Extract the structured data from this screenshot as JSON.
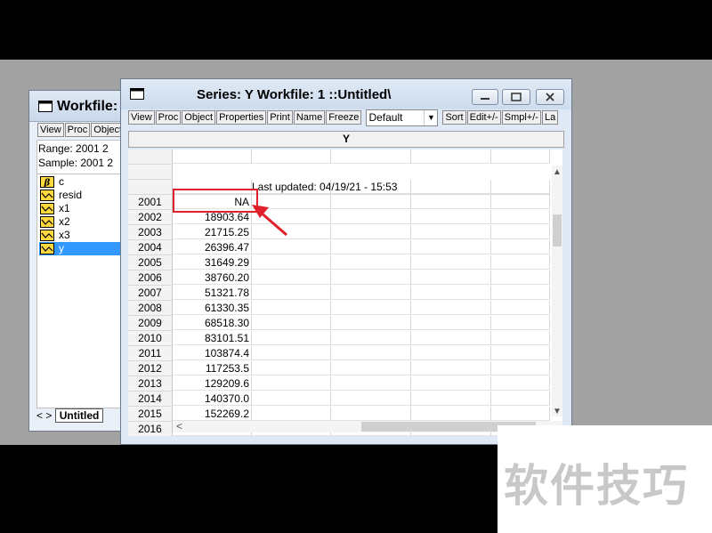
{
  "workfile_window": {
    "title": "Workfile:",
    "toolbar": [
      "View",
      "Proc",
      "Object"
    ],
    "range_line": "Range:   2001 2",
    "sample_line": "Sample: 2001 2",
    "objects": [
      {
        "label": "c",
        "icon": "beta-icon",
        "selected": false
      },
      {
        "label": "resid",
        "icon": "series-icon",
        "selected": false
      },
      {
        "label": "x1",
        "icon": "series-icon",
        "selected": false
      },
      {
        "label": "x2",
        "icon": "series-icon",
        "selected": false
      },
      {
        "label": "x3",
        "icon": "series-icon",
        "selected": false
      },
      {
        "label": "y",
        "icon": "series-icon",
        "selected": true
      }
    ],
    "tab_nav": "< >",
    "tab_label": "Untitled"
  },
  "series_window": {
    "title": "Series: Y   Workfile: 1 ::Untitled\\",
    "toolbar": [
      "View",
      "Proc",
      "Object",
      "Properties",
      "Print",
      "Name",
      "Freeze"
    ],
    "display_mode": "Default",
    "toolbar_right": [
      "Sort",
      "Edit+/-",
      "Smpl+/-",
      "La"
    ],
    "series_name": "Y",
    "last_updated": "Last updated: 04/19/21 - 15:53",
    "rows": [
      {
        "year": "2001",
        "value": "NA"
      },
      {
        "year": "2002",
        "value": "18903.64"
      },
      {
        "year": "2003",
        "value": "21715.25"
      },
      {
        "year": "2004",
        "value": "26396.47"
      },
      {
        "year": "2005",
        "value": "31649.29"
      },
      {
        "year": "2006",
        "value": "38760.20"
      },
      {
        "year": "2007",
        "value": "51321.78"
      },
      {
        "year": "2008",
        "value": "61330.35"
      },
      {
        "year": "2009",
        "value": "68518.30"
      },
      {
        "year": "2010",
        "value": "83101.51"
      },
      {
        "year": "2011",
        "value": "103874.4"
      },
      {
        "year": "2012",
        "value": "117253.5"
      },
      {
        "year": "2013",
        "value": "129209.6"
      },
      {
        "year": "2014",
        "value": "140370.0"
      },
      {
        "year": "2015",
        "value": "152269.2"
      },
      {
        "year": "2016",
        "value": ""
      }
    ]
  },
  "annotation": {
    "color": "#e0202a"
  },
  "watermark": "软件技巧"
}
